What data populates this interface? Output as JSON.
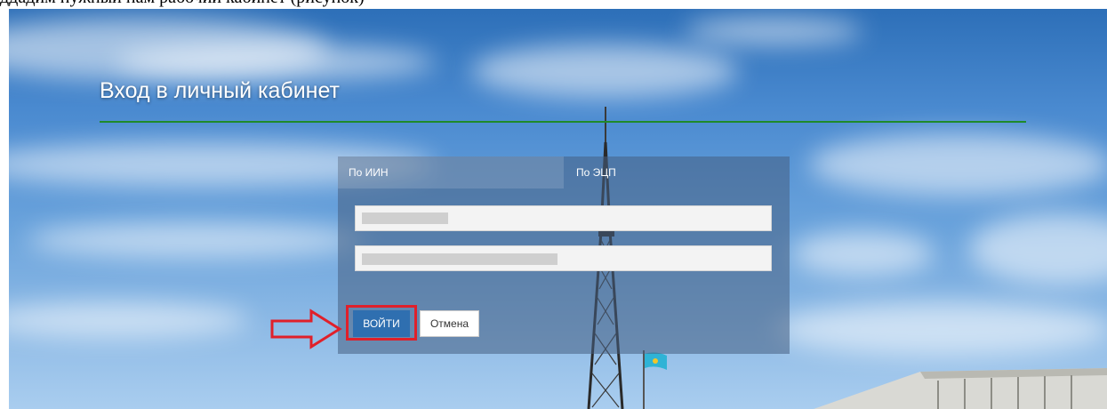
{
  "caption": "ддадим нужный нам рабочий кабинет (рисунок)",
  "login": {
    "title": "Вход в личный кабинет",
    "tabs": [
      {
        "label": "По ИИН"
      },
      {
        "label": "По ЭЦП"
      }
    ],
    "fields": {
      "login_value": "",
      "password_value": ""
    },
    "buttons": {
      "login_label": "ВОЙТИ",
      "cancel_label": "Отмена"
    }
  },
  "colors": {
    "accent_rule": "#1f8a2a",
    "highlight": "#e0202a",
    "login_button": "#2f6fb0"
  }
}
